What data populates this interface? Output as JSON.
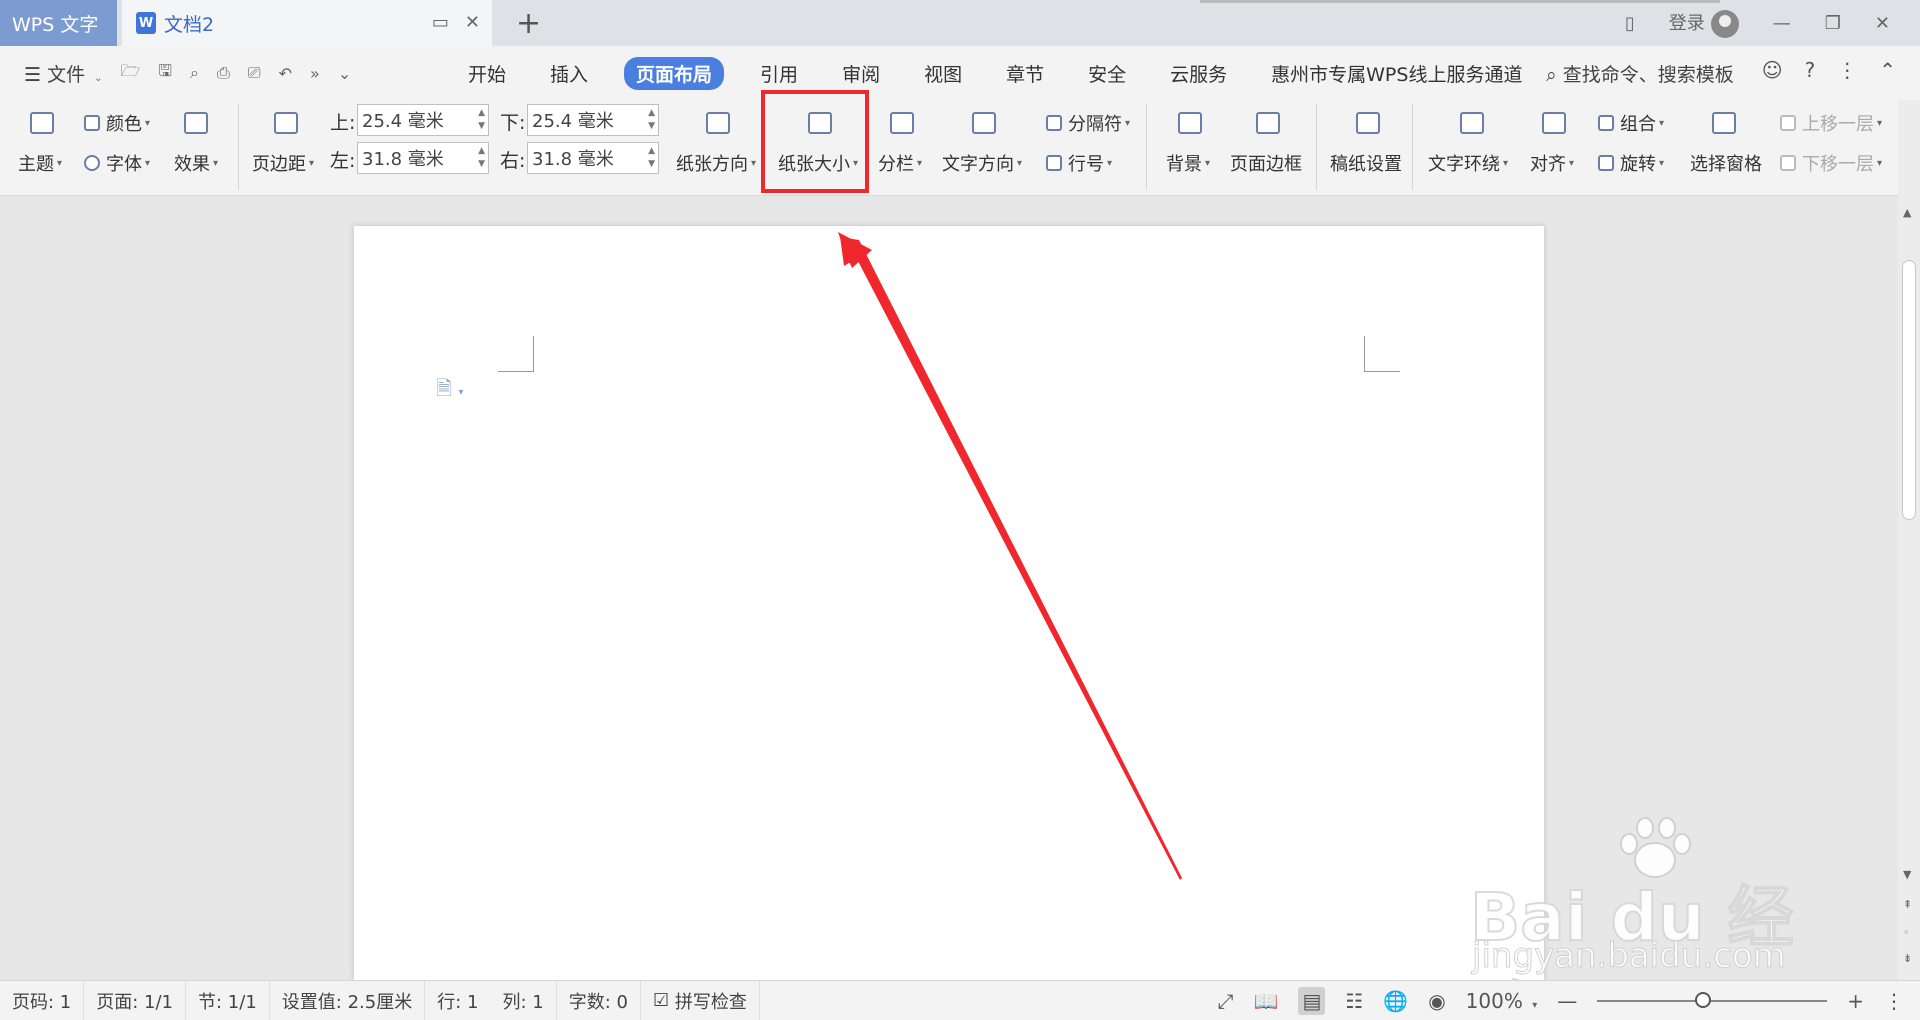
{
  "titlebar": {
    "app_name": "WPS 文字",
    "doc_tab": "文档2",
    "doc_tab_badge": "W",
    "new_tab_glyph": "+",
    "login_label": "登录"
  },
  "menubar": {
    "file_label": "文件",
    "tabs": [
      "开始",
      "插入",
      "页面布局",
      "引用",
      "审阅",
      "视图",
      "章节",
      "安全",
      "云服务",
      "惠州市专属WPS线上服务通道"
    ],
    "active_tab": "页面布局",
    "search_label": "查找命令、搜索模板"
  },
  "ribbon": {
    "theme": "主题",
    "color": "颜色",
    "font": "字体",
    "effect": "效果",
    "margins": "页边距",
    "top_label": "上:",
    "top_value": "25.4 毫米",
    "bottom_label": "下:",
    "bottom_value": "25.4 毫米",
    "left_label": "左:",
    "left_value": "31.8 毫米",
    "right_label": "右:",
    "right_value": "31.8 毫米",
    "orientation": "纸张方向",
    "paper_size": "纸张大小",
    "columns": "分栏",
    "text_direction": "文字方向",
    "separator": "分隔符",
    "line_number": "行号",
    "background": "背景",
    "page_border": "页面边框",
    "manuscript": "稿纸设置",
    "text_wrap": "文字环绕",
    "align": "对齐",
    "group": "组合",
    "rotate": "旋转",
    "selection_pane": "选择窗格",
    "bring_forward": "上移一层",
    "send_backward": "下移一层"
  },
  "status": {
    "page_code": "页码: 1",
    "pages": "页面: 1/1",
    "section": "节: 1/1",
    "setting": "设置值: 2.5厘米",
    "row": "行: 1",
    "col": "列: 1",
    "word_count": "字数: 0",
    "spell_check": "拼写检查",
    "zoom": "100%"
  },
  "watermark": {
    "brand": "Bai du 经验",
    "url": "jingyan.baidu.com"
  },
  "colors": {
    "accent": "#4a7fe0",
    "highlight_box": "#f0282d",
    "arrow": "#f0282d"
  }
}
